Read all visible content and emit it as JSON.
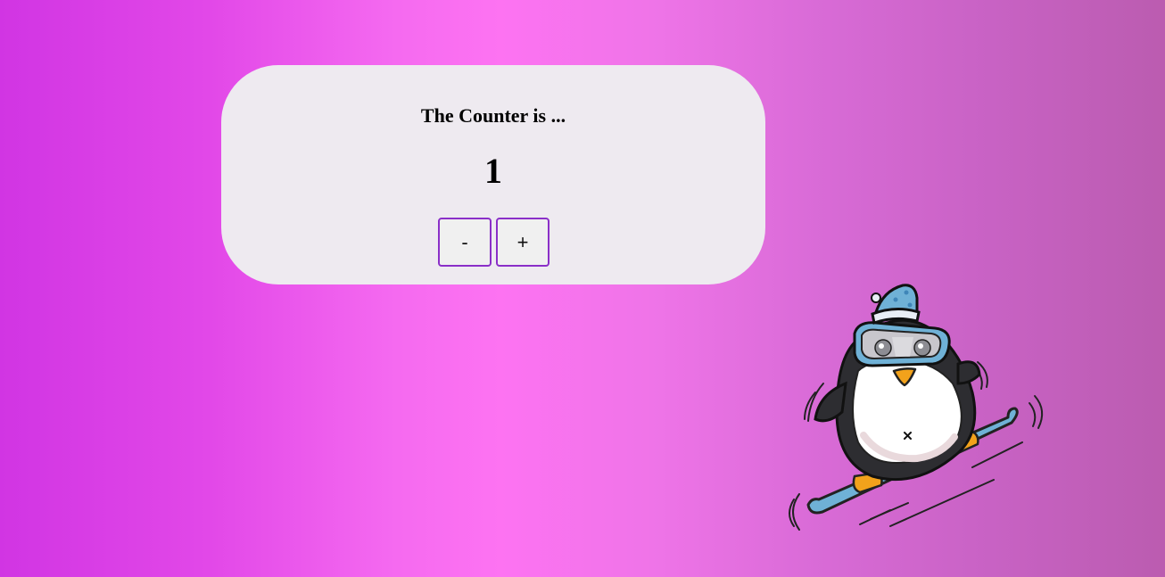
{
  "counter": {
    "heading": "The Counter is ...",
    "value": "1",
    "decrement_label": "-",
    "increment_label": "+"
  },
  "illustration": {
    "subject": "penguin-skiing"
  },
  "colors": {
    "card_bg": "#eeeaf0",
    "button_border": "#8a2fc8",
    "bg_gradient_start": "#d135e3",
    "bg_gradient_mid": "#fd73f2",
    "bg_gradient_end": "#bb5cb0"
  }
}
